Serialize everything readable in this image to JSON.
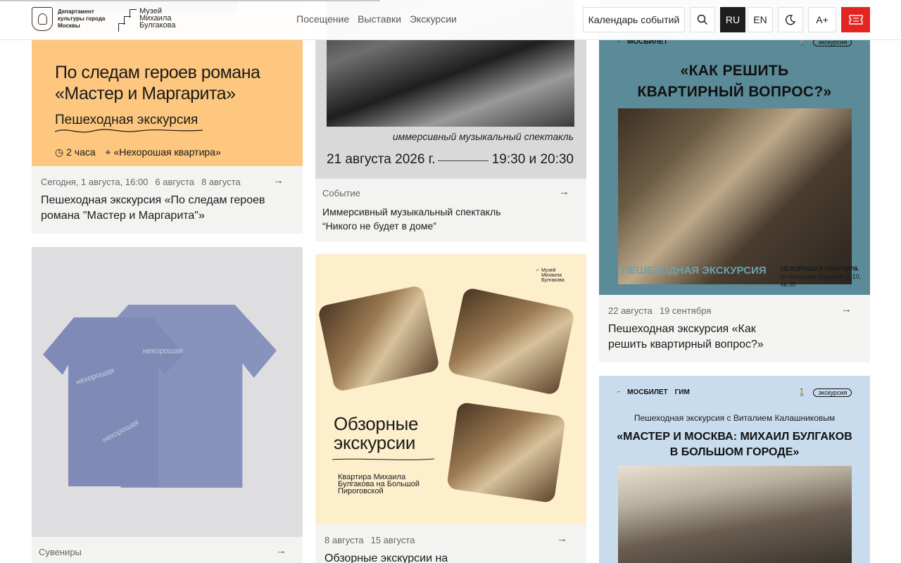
{
  "header": {
    "dept_text": "Департамент культуры города Москвы",
    "museum_lines": [
      "Музей",
      "Михаила",
      "Булгакова"
    ],
    "nav": [
      "Посещение",
      "Выставки",
      "Экскурсии"
    ],
    "calendar_label": "Календарь событий",
    "lang_ru": "RU",
    "lang_en": "EN",
    "font_size_label": "A+"
  },
  "cards": {
    "c1": {
      "heading": "По следам героев романа «Мастер и Маргарита»",
      "subtitle": "Пешеходная экскурсия",
      "duration": "2 часа",
      "place": "«Нехорошая квартира»",
      "dates": [
        "Сегодня, 1 августа, 16:00",
        "6 августа",
        "8 августа"
      ],
      "title": "Пешеходная экскурсия «По следам героев романа \"Мастер и Маргарита\"»"
    },
    "c2": {
      "caption": "иммерсивный музыкальный спектакль",
      "date": "21 августа 2026 г.",
      "time": "19:30 и 20:30",
      "category": "Событие",
      "title": "Иммерсивный музыкальный спектакль “Никого не будет в доме”"
    },
    "c3": {
      "logo_mos": "МОС",
      "logo_bilet": "БИЛЕТ",
      "pill": "экскурсия",
      "heading": "«КАК РЕШИТЬ КВАРТИРНЫЙ ВОПРОС?»",
      "tag": "ПЕШЕХОДНАЯ ЭКСКУРСИЯ",
      "place": "НЕХОРОШАЯ КВАРТИРА",
      "address": "ул.Большая Садовая, д.10, кв.50",
      "dates": [
        "22 августа",
        "19 сентября"
      ],
      "title": "Пешеходная экскурсия «Как решить квартирный вопрос?»"
    },
    "c4": {
      "category": "Сувениры",
      "shirt_text": "нехорошая"
    },
    "c5": {
      "heading": "Обзорные экскурсии",
      "subtitle": "Квартира Михаила Булгакова на Большой Пироговской",
      "dates": [
        "8 августа",
        "15 августа"
      ],
      "title": "Обзорные экскурсии на"
    },
    "c6": {
      "logo_mos": "МОС",
      "logo_bilet": "БИЛЕТ",
      "logo_gim": "ГИМ",
      "pill": "экскурсия",
      "lead": "Пешеходная экскурсия с Виталием Калашниковым",
      "heading": "«МАСТЕР И МОСКВА: МИХАИЛ БУЛГАКОВ В БОЛЬШОМ ГОРОДЕ»"
    }
  },
  "colors": {
    "accent_red": "#e42421",
    "orange_card": "#fdc77f",
    "teal_card": "#5b8b98",
    "yellow_card": "#fdefcc",
    "blue_card": "#c9dcee",
    "card_bg": "#f3f3f1"
  }
}
